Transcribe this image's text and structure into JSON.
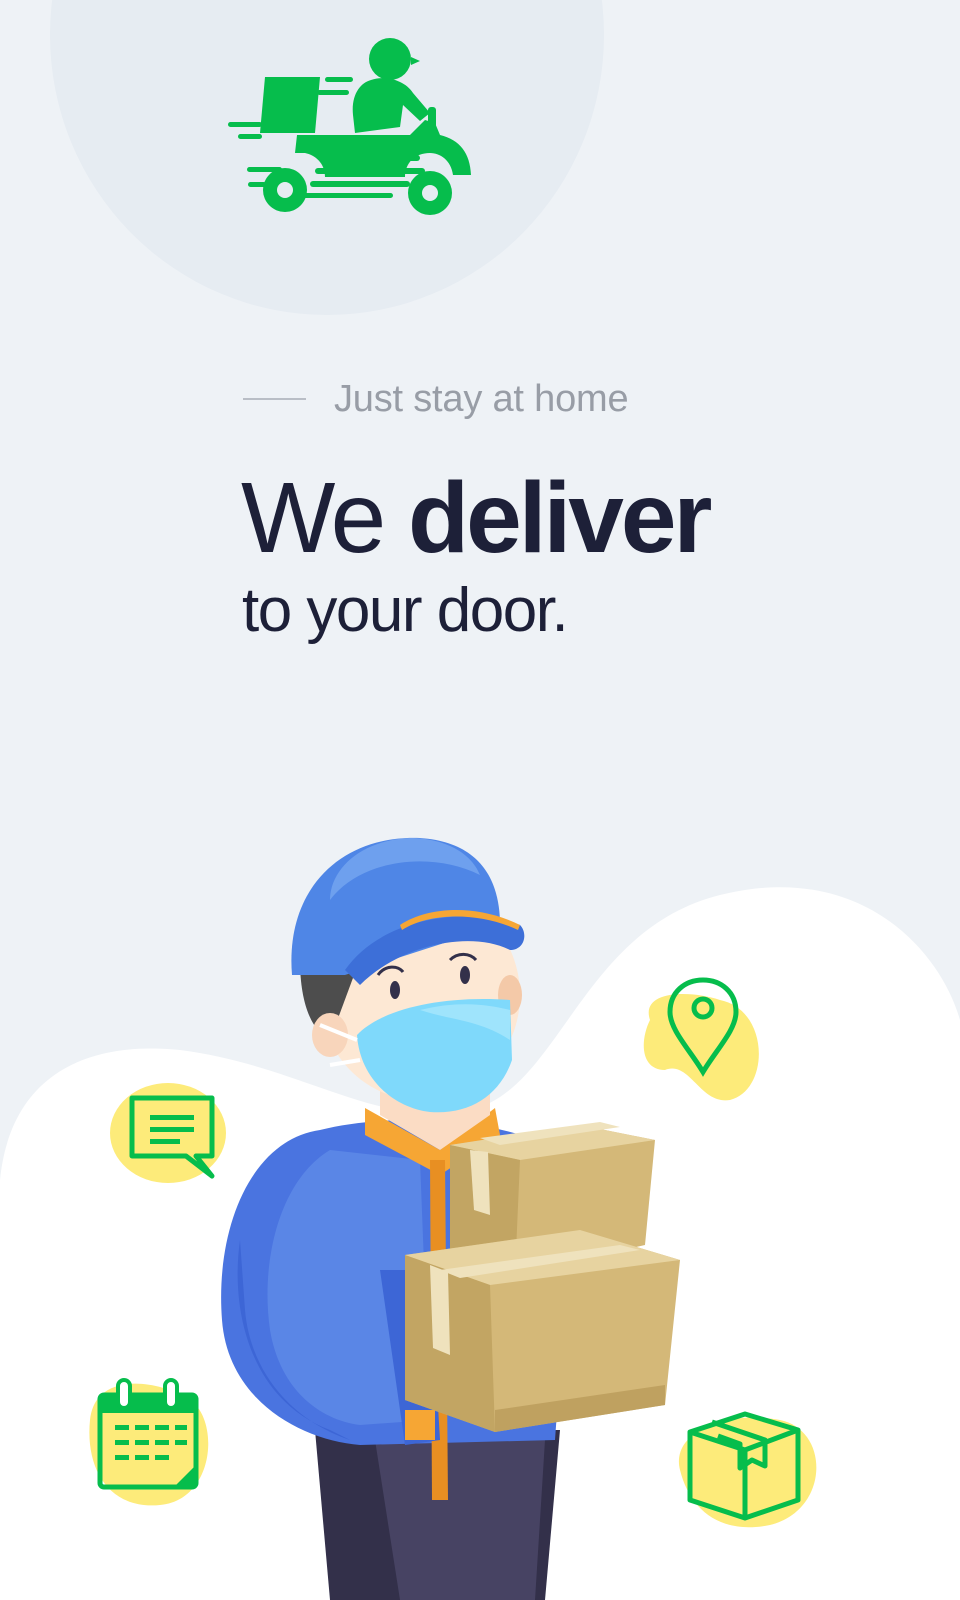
{
  "colors": {
    "background": "#eef2f6",
    "accent_green": "#06bd4c",
    "accent_yellow": "#fdeb7a",
    "headline": "#1d2038",
    "tagline": "#989da6"
  },
  "logo": {
    "icon": "delivery-scooter-icon"
  },
  "hero": {
    "tagline": "Just stay at home",
    "headline_light": "We",
    "headline_bold": "deliver",
    "subline": "to your door."
  },
  "illustration": {
    "figure": "delivery-courier-with-boxes",
    "icons": [
      "chat-bubble-icon",
      "location-pin-icon",
      "calendar-icon",
      "package-box-icon"
    ]
  }
}
